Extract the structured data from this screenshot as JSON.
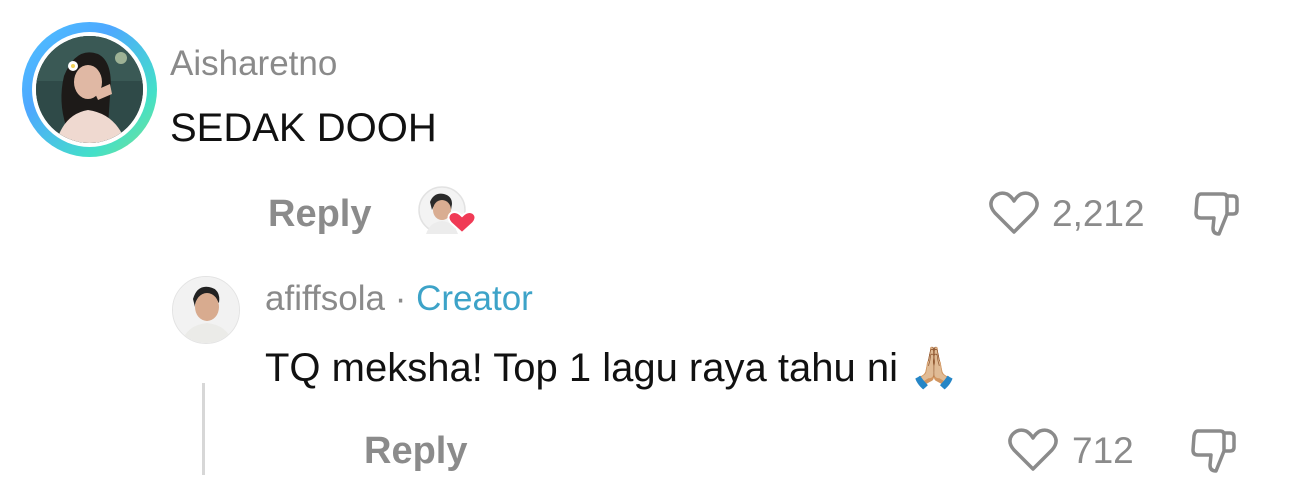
{
  "comment": {
    "username": "Aisharetno",
    "text": "SEDAK DOOH",
    "reply_label": "Reply",
    "like_count": "2,212"
  },
  "reply": {
    "username": "afiffsola",
    "separator": " · ",
    "badge": "Creator",
    "text": "TQ meksha! Top 1 lagu raya tahu ni",
    "emoji": "🙏🏼",
    "reply_label": "Reply",
    "like_count": "712"
  },
  "icons": {
    "like": "heart-outline-icon",
    "dislike": "thumbs-down-icon",
    "creator_liked": "creator-heart-badge-icon"
  },
  "colors": {
    "muted_text": "#8b8b8b",
    "creator_badge": "#3da3c8",
    "heart_red": "#f03a55"
  }
}
